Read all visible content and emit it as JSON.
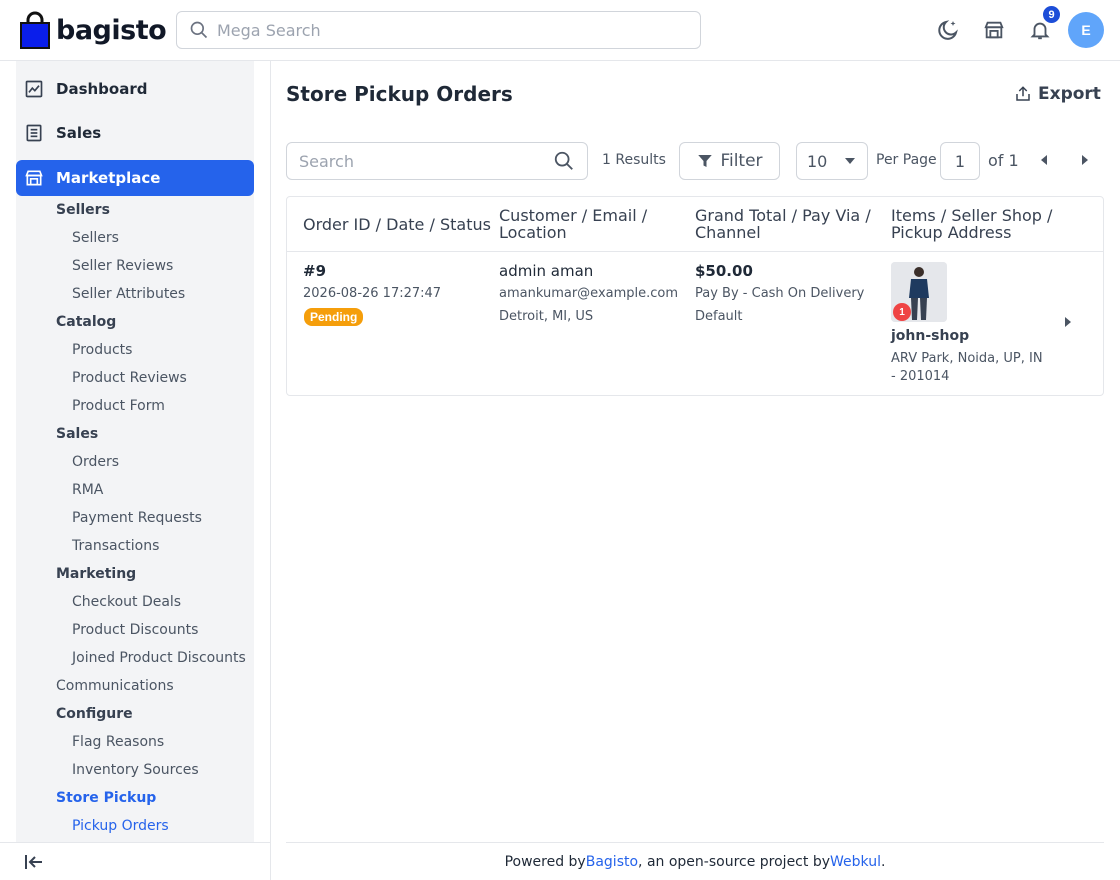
{
  "header": {
    "brand": "bagisto",
    "search_placeholder": "Mega Search",
    "notification_count": "9",
    "avatar_initial": "E"
  },
  "sidebar": {
    "top_items": [
      {
        "label": "Dashboard",
        "icon": "dashboard-icon"
      },
      {
        "label": "Sales",
        "icon": "sales-icon"
      },
      {
        "label": "Marketplace",
        "icon": "store-icon"
      }
    ],
    "sections": {
      "sellers": "Sellers",
      "sellers_items": [
        "Sellers",
        "Seller Reviews",
        "Seller Attributes"
      ],
      "catalog": "Catalog",
      "catalog_items": [
        "Products",
        "Product Reviews",
        "Product Form"
      ],
      "sales": "Sales",
      "sales_items": [
        "Orders",
        "RMA",
        "Payment Requests",
        "Transactions"
      ],
      "marketing": "Marketing",
      "marketing_items": [
        "Checkout Deals",
        "Product Discounts",
        "Joined Product Discounts"
      ],
      "communications": "Communications",
      "configure": "Configure",
      "configure_items": [
        "Flag Reasons",
        "Inventory Sources"
      ],
      "store_pickup": "Store Pickup",
      "store_pickup_items": [
        "Pickup Orders"
      ]
    }
  },
  "main": {
    "title": "Store Pickup Orders",
    "export_label": "Export",
    "search_placeholder": "Search",
    "results": "1 Results",
    "filter_label": "Filter",
    "per_page_value": "10",
    "per_page_label": "Per Page",
    "page_value": "1",
    "page_of": "of 1"
  },
  "table": {
    "headers": [
      {
        "line1": "Order ID / Date / Status",
        "line2": ""
      },
      {
        "line1": "Customer / Email /",
        "line2": "Location"
      },
      {
        "line1": "Grand Total / Pay Via /",
        "line2": "Channel"
      },
      {
        "line1": "Items / Seller Shop /",
        "line2": "Pickup Address"
      }
    ],
    "rows": [
      {
        "order_id": "#9",
        "date": "2026-08-26 17:27:47",
        "status": "Pending",
        "customer": "admin aman",
        "email": "amankumar@example.com",
        "location": "Detroit, MI, US",
        "grand_total": "$50.00",
        "pay_via": "Pay By - Cash On Delivery",
        "channel": "Default",
        "item_qty": "1",
        "seller_shop": "john-shop",
        "pickup_line1": "ARV Park, Noida, UP, IN",
        "pickup_line2": "- 201014"
      }
    ]
  },
  "footer": {
    "prefix": "Powered by ",
    "link1": "Bagisto",
    "middle": ", an open-source project by ",
    "link2": "Webkul",
    "suffix": "."
  }
}
